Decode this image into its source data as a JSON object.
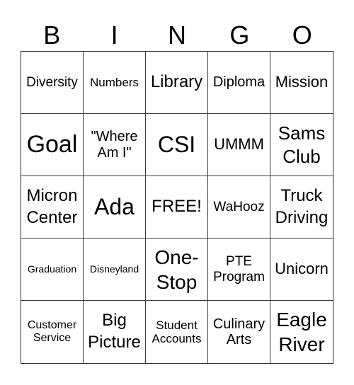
{
  "header": {
    "letters": [
      "B",
      "I",
      "N",
      "G",
      "O"
    ]
  },
  "board": {
    "cells": [
      "Diversity",
      "Numbers",
      "Library",
      "Diploma",
      "Mission",
      "Goal",
      "\"Where\nAm I\"",
      "CSI",
      "UMMM",
      "Sams\nClub",
      "Micron\nCenter",
      "Ada",
      "FREE!",
      "WaHooz",
      "Truck\nDriving",
      "Graduation",
      "Disneyland",
      "One-\nStop",
      "PTE\nProgram",
      "Unicorn",
      "Customer\nService",
      "Big\nPicture",
      "Student\nAccounts",
      "Culinary\nArts",
      "Eagle\nRiver"
    ],
    "free_space_label": "FREE!"
  }
}
